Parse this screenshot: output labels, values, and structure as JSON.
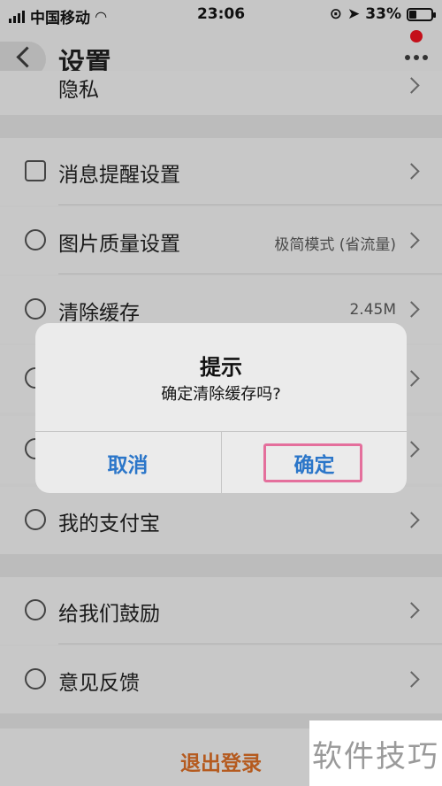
{
  "status_bar": {
    "carrier": "中国移动",
    "time": "23:06",
    "battery": "33%",
    "battery_level": 0.33
  },
  "nav": {
    "title": "设置"
  },
  "list": {
    "partial_top_label": "隐私",
    "notification_label": "消息提醒设置",
    "image_quality_label": "图片质量设置",
    "image_quality_value": "极简模式 (省流量)",
    "clear_cache_label": "清除缓存",
    "clear_cache_value": "2.45M",
    "alipay_label": "我的支付宝",
    "encourage_label": "给我们鼓励",
    "feedback_label": "意见反馈"
  },
  "dialog": {
    "title": "提示",
    "message": "确定清除缓存吗?",
    "cancel": "取消",
    "confirm": "确定"
  },
  "logout": {
    "label": "退出登录"
  },
  "watermark": {
    "text": "软件技巧"
  }
}
